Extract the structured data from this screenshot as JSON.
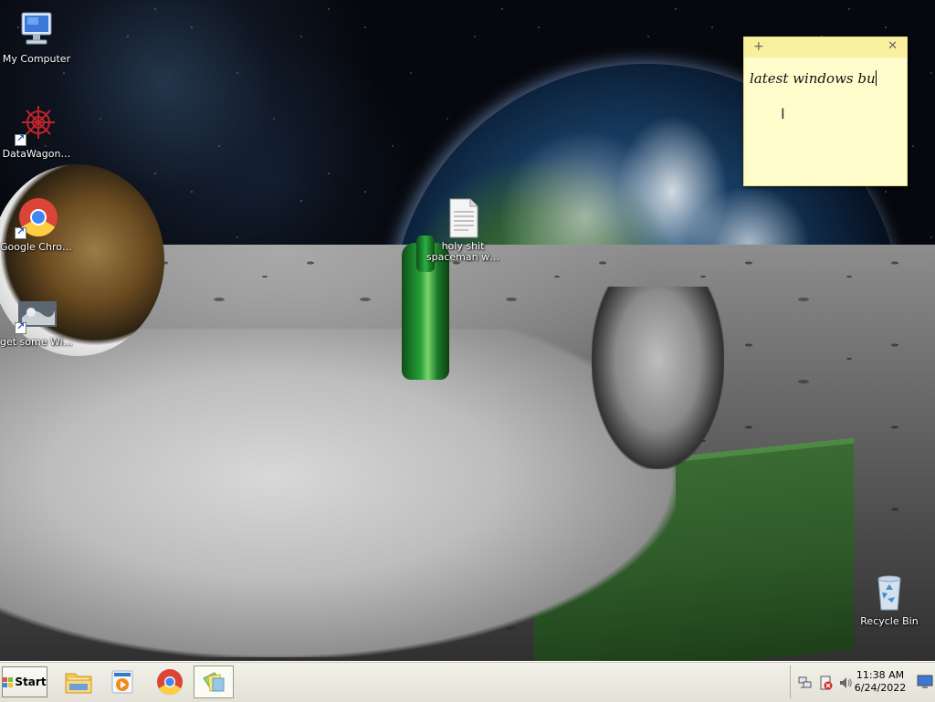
{
  "desktop": {
    "icons": [
      {
        "label": "My Computer",
        "icon": "computer-icon"
      },
      {
        "label": "DataWagon…",
        "icon": "datawagon-icon"
      },
      {
        "label": "Google Chrome",
        "icon": "chrome-icon"
      },
      {
        "label": "get some Wine",
        "icon": "wine-icon"
      },
      {
        "label": "holy shit spaceman w…",
        "icon": "text-file-icon"
      },
      {
        "label": "Recycle Bin",
        "icon": "recycle-bin-icon"
      }
    ]
  },
  "sticky_note": {
    "text": "latest windows bu",
    "color": "#fefdcb"
  },
  "taskbar": {
    "start_label": "Start",
    "pinned": [
      {
        "name": "explorer",
        "icon": "folder-icon"
      },
      {
        "name": "media-player",
        "icon": "media-player-icon"
      },
      {
        "name": "chrome",
        "icon": "chrome-icon"
      },
      {
        "name": "sticky-notes",
        "icon": "sticky-notes-icon",
        "active": true
      }
    ],
    "clock": {
      "time": "11:38 AM",
      "date": "6/24/2022"
    }
  }
}
